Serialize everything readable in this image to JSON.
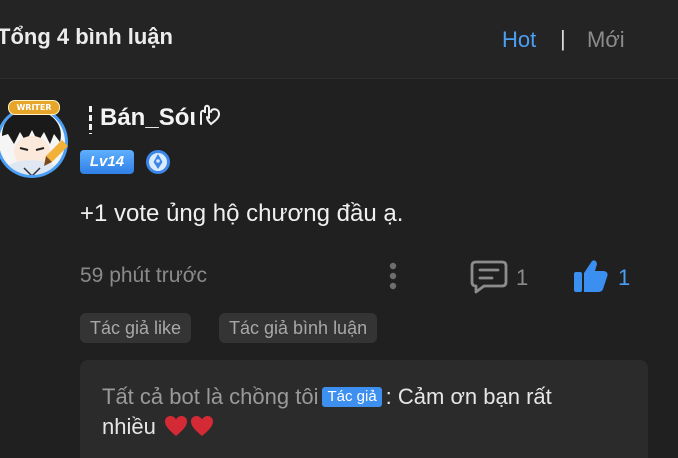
{
  "header": {
    "total_label": "Tổng 4 bình luận",
    "sort_hot": "Hot",
    "sort_divider": "|",
    "sort_new": "Mới"
  },
  "comment": {
    "username": "Bán_Sóι",
    "username_suffix_icon": "hand-heart-icon",
    "avatar_badge": "WRITER",
    "level": "Lv14",
    "verified_icon": "pen-badge-icon",
    "text": "+1 vote ủng hộ chương đầu ạ.",
    "time": "59 phút trước",
    "reply_count": "1",
    "like_count": "1",
    "tags": [
      "Tác giả like",
      "Tác giả bình luận"
    ]
  },
  "reply": {
    "author": "Tất cả bot là chồng tôi",
    "author_badge": "Tác giả",
    "separator": ":",
    "text_line1": "Cảm ơn bạn rất",
    "text_line2": "nhiều",
    "hearts": 2
  },
  "colors": {
    "accent": "#4a9ff5",
    "background": "#202020",
    "heart": "#d42a35"
  }
}
